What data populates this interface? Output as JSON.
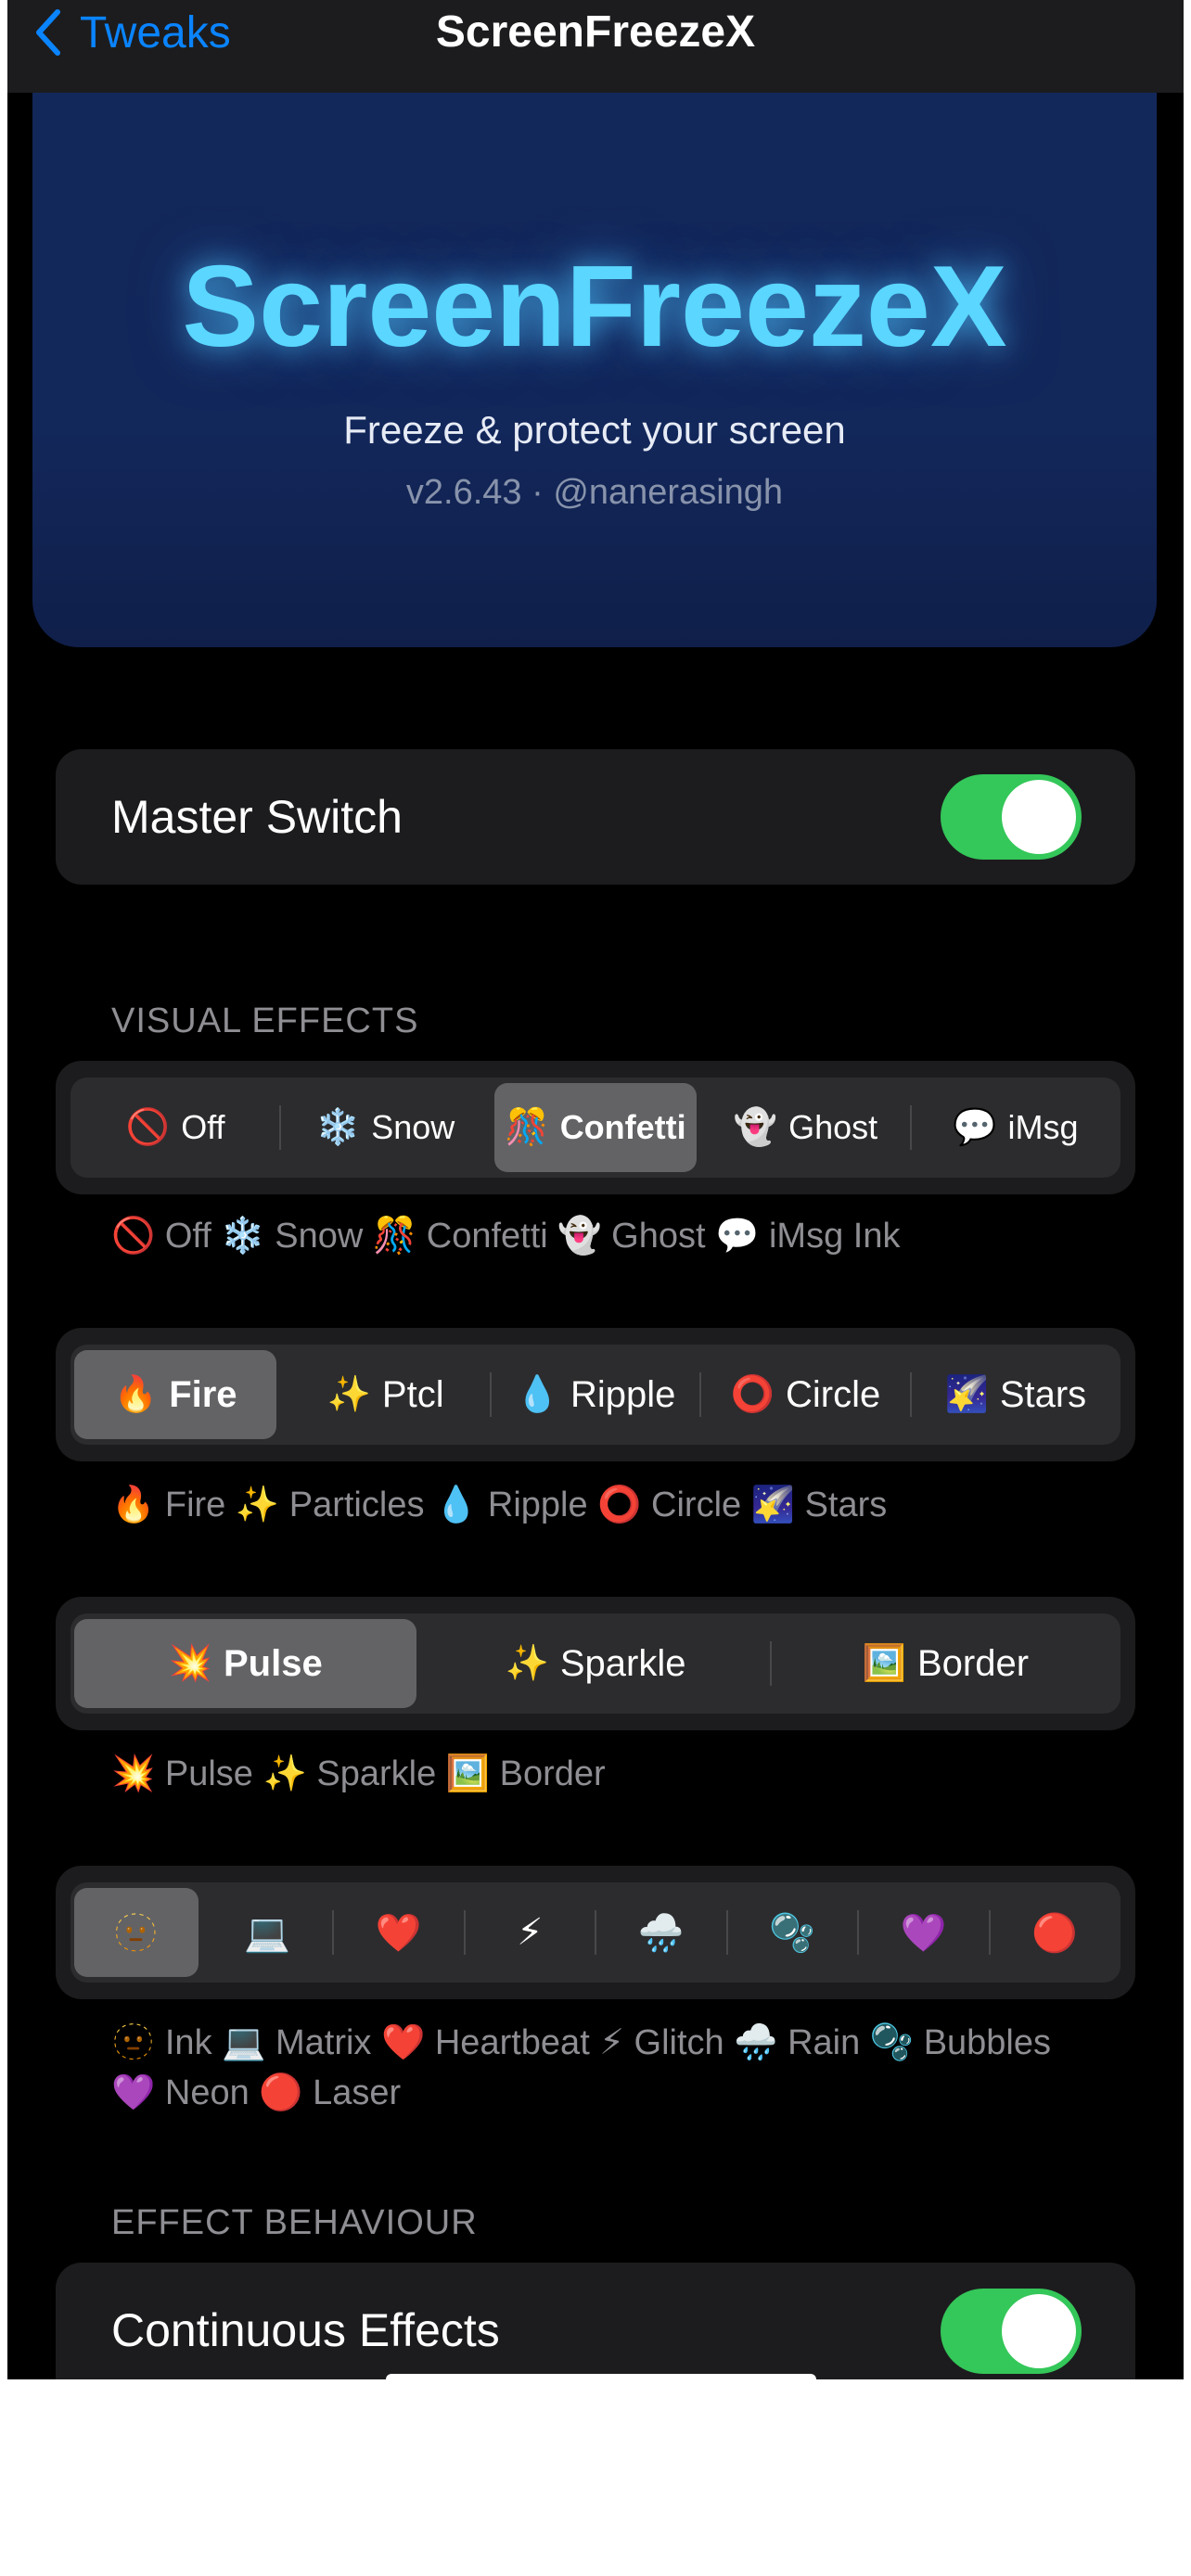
{
  "nav": {
    "back_label": "Tweaks",
    "title": "ScreenFreezeX"
  },
  "hero": {
    "title": "ScreenFreezeX",
    "subtitle": "Freeze & protect your screen",
    "version_line": "v2.6.43  ·  @nanerasingh"
  },
  "master": {
    "label": "Master Switch",
    "on": true
  },
  "visual_effects": {
    "header": "VISUAL EFFECTS",
    "row1": {
      "items": [
        {
          "emoji": "🚫",
          "label": "Off"
        },
        {
          "emoji": "❄️",
          "label": "Snow"
        },
        {
          "emoji": "🎊",
          "label": "Confetti"
        },
        {
          "emoji": "👻",
          "label": "Ghost"
        },
        {
          "emoji": "💬",
          "label": "iMsg"
        }
      ],
      "selected": "Confetti",
      "caption": "🚫 Off  ❄️ Snow  🎊 Confetti  👻 Ghost  💬 iMsg Ink"
    },
    "row2": {
      "items": [
        {
          "emoji": "🔥",
          "label": "Fire"
        },
        {
          "emoji": "✨",
          "label": "Ptcl"
        },
        {
          "emoji": "💧",
          "label": "Ripple"
        },
        {
          "emoji": "⭕",
          "label": "Circle"
        },
        {
          "emoji": "🌠",
          "label": "Stars"
        }
      ],
      "selected": "Fire",
      "caption": "🔥 Fire  ✨ Particles  💧 Ripple  ⭕ Circle  🌠 Stars"
    },
    "row3": {
      "items": [
        {
          "emoji": "💥",
          "label": "Pulse"
        },
        {
          "emoji": "✨",
          "label": "Sparkle"
        },
        {
          "emoji": "🖼️",
          "label": "Border"
        }
      ],
      "selected": "Pulse",
      "caption": "💥 Pulse  ✨ Sparkle  🖼️ Border"
    },
    "row4": {
      "items": [
        {
          "emoji": "🫥"
        },
        {
          "emoji": "💻"
        },
        {
          "emoji": "❤️"
        },
        {
          "emoji": "⚡"
        },
        {
          "emoji": "🌧️"
        },
        {
          "emoji": "🫧"
        },
        {
          "emoji": "💜"
        },
        {
          "emoji": "🔴"
        }
      ],
      "selected_index": 0,
      "caption": "🫥 Ink  💻 Matrix  ❤️ Heartbeat  ⚡ Glitch  🌧️ Rain  🫧 Bubbles  💜 Neon  🔴 Laser"
    }
  },
  "effect_behaviour": {
    "header": "EFFECT BEHAVIOUR",
    "continuous": {
      "label": "Continuous Effects",
      "on": true
    }
  }
}
